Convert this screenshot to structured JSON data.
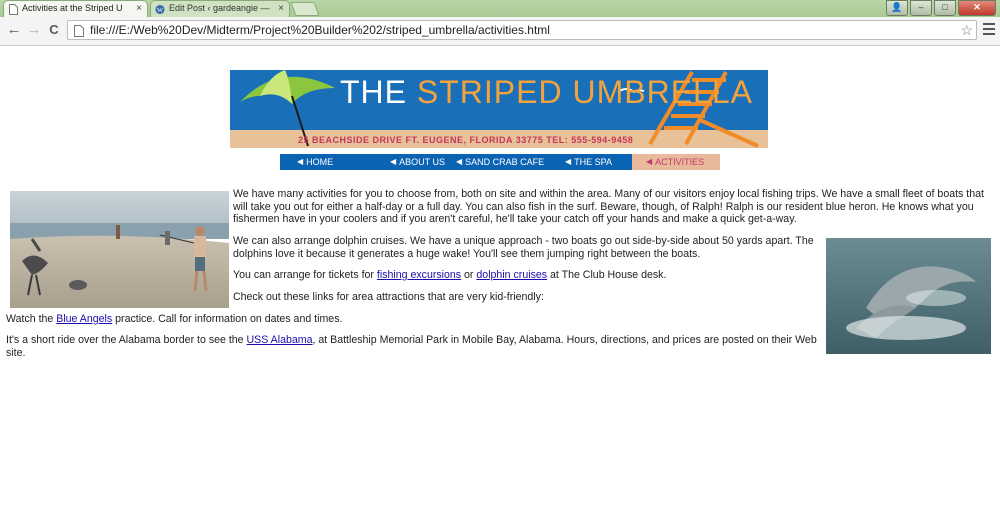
{
  "browser": {
    "tabs": [
      {
        "title": "Activities at the Striped U",
        "active": true
      },
      {
        "title": "Edit Post ‹ gardeangie —",
        "active": false
      }
    ],
    "close_glyph": "×",
    "window_controls": {
      "profile": "👤",
      "minimize": "–",
      "maximize": "□",
      "close": "✕"
    },
    "url": "file:///E:/Web%20Dev/Midterm/Project%20Builder%202/striped_umbrella/activities.html",
    "icons": {
      "back": "back-arrow-icon",
      "forward": "forward-arrow-icon",
      "reload": "reload-icon",
      "star": "star-icon",
      "menu": "hamburger-menu-icon"
    },
    "glyphs": {
      "back": "←",
      "forward": "→",
      "reload": "C",
      "star": "☆"
    }
  },
  "banner": {
    "title_part1": "THE ",
    "title_part2": "STRIPED UMBRELLA",
    "address": "25 BEACHSIDE DRIVE   FT. EUGENE, FLORIDA 33775    TEL: 555-594-9458"
  },
  "nav": [
    {
      "label": "HOME",
      "active": false
    },
    {
      "label": "ABOUT US",
      "active": false
    },
    {
      "label": "SAND CRAB CAFE",
      "active": false
    },
    {
      "label": "THE SPA",
      "active": false
    },
    {
      "label": "ACTIVITIES",
      "active": true
    }
  ],
  "nav_arrow": "◀",
  "content": {
    "p1": "We have many activities for you to choose from, both on site and within the area. Many of our visitors enjoy local fishing trips. We have a small fleet of boats that will take you out for either a half-day or a full day. You can also fish in the surf. Beware, though, of Ralph! Ralph is our resident blue heron. He knows what you fishermen have in your coolers and if you aren't careful, he'll take your catch off your hands and make a quick get-a-way.",
    "p2": "We can also arrange dolphin cruises. We have a unique approach - two boats go out side-by-side about 50 yards apart. The dolphins love it because it generates a huge wake! You'll see them jumping right between the boats.",
    "p3_before": "You can arrange for tickets for ",
    "p3_link1": "fishing excursions",
    "p3_mid": " or ",
    "p3_link2": "dolphin cruises",
    "p3_after": " at The Club House desk.",
    "p4": "Check out these links for area attractions that are very kid-friendly:",
    "p5_before": "Watch the ",
    "p5_link": "Blue Angels",
    "p5_after": " practice. Call for information on dates and times.",
    "p6_before": "It's a short ride over the Alabama border to see the ",
    "p6_link": "USS Alabama",
    "p6_after": ", at Battleship Memorial Park in Mobile Bay, Alabama. Hours, directions, and prices are posted on their Web site."
  }
}
